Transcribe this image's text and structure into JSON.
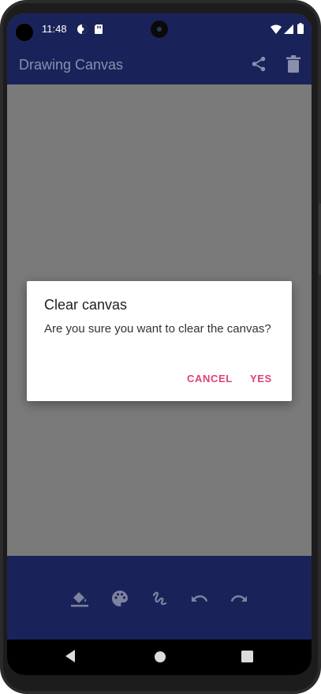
{
  "status_bar": {
    "time": "11:48"
  },
  "app_bar": {
    "title": "Drawing Canvas"
  },
  "dialog": {
    "title": "Clear canvas",
    "message": "Are you sure you want to clear the canvas?",
    "cancel_label": "CANCEL",
    "confirm_label": "YES"
  },
  "toolbar": {
    "tools": [
      "fill-bucket-icon",
      "palette-icon",
      "brush-icon",
      "undo-icon",
      "redo-icon"
    ]
  },
  "colors": {
    "app_bar": "#1a2359",
    "dialog_button": "#e0407b",
    "scrim_canvas": "#7a7a7a"
  }
}
